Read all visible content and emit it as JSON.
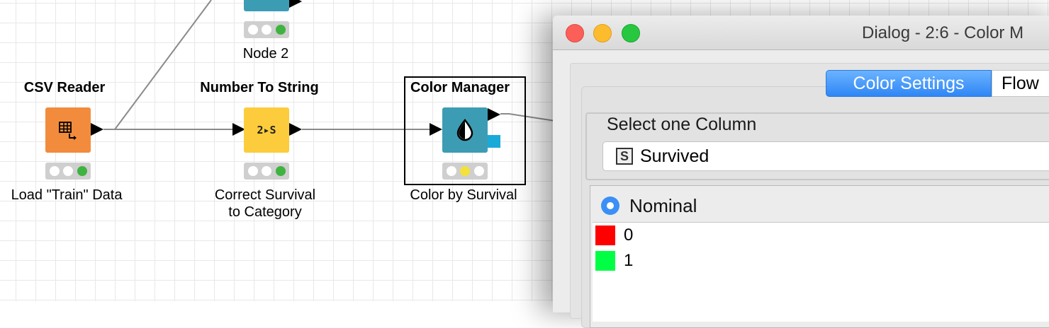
{
  "workflow": {
    "nodes": [
      {
        "title": "",
        "label": "Node 2",
        "color": "#3c9cb4",
        "status": [
          "off",
          "off",
          "green"
        ]
      },
      {
        "title": "CSV Reader",
        "label": "Load \"Train\" Data",
        "color": "#f28c3c",
        "status": [
          "off",
          "off",
          "green"
        ]
      },
      {
        "title": "Number To String",
        "label_line1": "Correct Survival",
        "label_line2": "to Category",
        "icon_text": "2▸S",
        "color": "#fccc3c",
        "status": [
          "off",
          "off",
          "green"
        ]
      },
      {
        "title": "Color Manager",
        "label": "Color by Survival",
        "color": "#3c9cb4",
        "status": [
          "off",
          "yellow",
          "off"
        ],
        "selected": true
      }
    ]
  },
  "dialog": {
    "title": "Dialog - 2:6 - Color M",
    "tabs": [
      {
        "label": "Color Settings",
        "active": true
      },
      {
        "label": "Flow",
        "active": false
      }
    ],
    "column_group_title": "Select one Column",
    "selected_column": {
      "type_badge": "S",
      "name": "Survived"
    },
    "nominal_label": "Nominal",
    "values": [
      {
        "label": "0",
        "color": "#ff0000"
      },
      {
        "label": "1",
        "color": "#00ff44"
      }
    ]
  }
}
